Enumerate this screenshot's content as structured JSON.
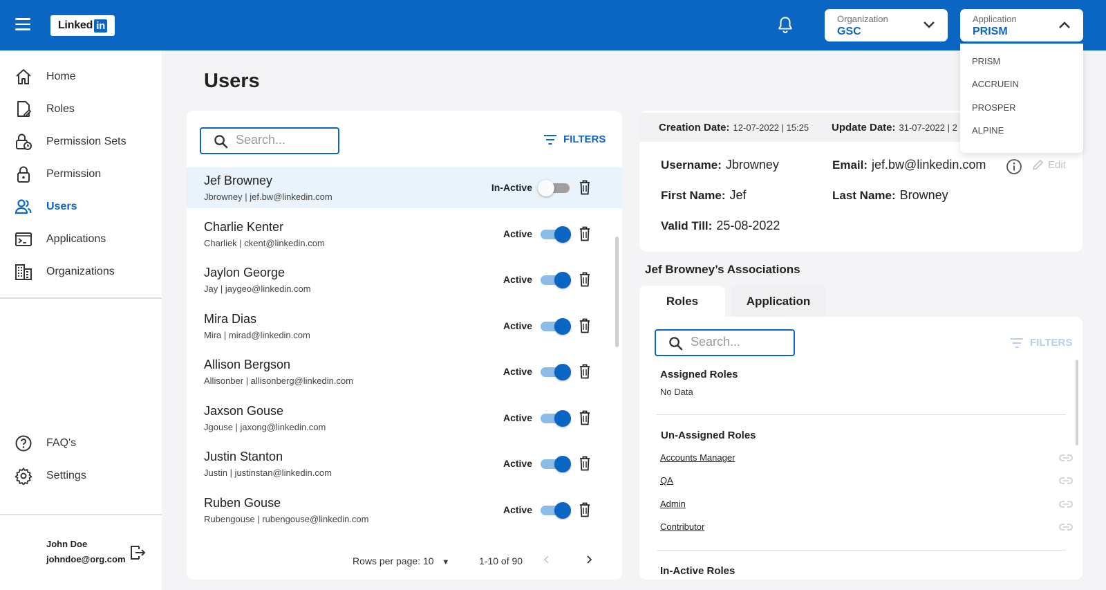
{
  "header": {
    "logo_text": "Linked",
    "logo_in": "in",
    "organization": {
      "label": "Organization",
      "value": "GSC"
    },
    "application": {
      "label": "Application",
      "value": "PRISM",
      "options": [
        "PRISM",
        "ACCRUEIN",
        "PROSPER",
        "ALPINE"
      ]
    }
  },
  "sidebar": {
    "items": [
      {
        "label": "Home",
        "icon": "home-icon"
      },
      {
        "label": "Roles",
        "icon": "roles-icon"
      },
      {
        "label": "Permission Sets",
        "icon": "permission-sets-icon"
      },
      {
        "label": "Permission",
        "icon": "lock-icon"
      },
      {
        "label": "Users",
        "icon": "users-icon",
        "active": true
      },
      {
        "label": "Applications",
        "icon": "terminal-icon"
      },
      {
        "label": "Organizations",
        "icon": "building-icon"
      }
    ],
    "bottom": [
      {
        "label": "FAQ's",
        "icon": "help-icon"
      },
      {
        "label": "Settings",
        "icon": "gear-icon"
      }
    ],
    "user": {
      "name": "John Doe",
      "email": "johndoe@org.com"
    }
  },
  "page": {
    "title": "Users"
  },
  "users_panel": {
    "search_placeholder": "Search...",
    "filters_label": "FILTERS",
    "users": [
      {
        "name": "Jef Browney",
        "sub": "Jbrowney | jef.bw@linkedin.com",
        "status": "In-Active",
        "active": false,
        "selected": true
      },
      {
        "name": "Charlie Kenter",
        "sub": "Charliek | ckent@linkedin.com",
        "status": "Active",
        "active": true
      },
      {
        "name": "Jaylon George",
        "sub": "Jay | jaygeo@linkedin.com",
        "status": "Active",
        "active": true
      },
      {
        "name": "Mira Dias",
        "sub": "Mira | mirad@linkedin.com",
        "status": "Active",
        "active": true
      },
      {
        "name": "Allison Bergson",
        "sub": "Allisonber | allisonberg@linkedin.com",
        "status": "Active",
        "active": true
      },
      {
        "name": "Jaxson Gouse",
        "sub": "Jgouse | jaxong@linkedin.com",
        "status": "Active",
        "active": true
      },
      {
        "name": "Justin Stanton",
        "sub": "Justin | justinstan@linkedin.com",
        "status": "Active",
        "active": true
      },
      {
        "name": "Ruben Gouse",
        "sub": "Rubengouse | rubengouse@linkedin.com",
        "status": "Active",
        "active": true
      }
    ],
    "pagination": {
      "rows_per_page": "Rows per page: 10",
      "range": "1-10 of 90"
    }
  },
  "details": {
    "creation_label": "Creation Date:",
    "creation_value": "12-07-2022 | 15:25",
    "update_label": "Update Date:",
    "update_value": "31-07-2022 | 2",
    "username_label": "Username:",
    "username": "Jbrowney",
    "email_label": "Email:",
    "email": "jef.bw@linkedin.com",
    "firstname_label": "First Name:",
    "firstname": "Jef",
    "lastname_label": "Last Name:",
    "lastname": "Browney",
    "validtill_label": "Valid Till:",
    "validtill": "25-08-2022",
    "edit_label": "Edit"
  },
  "associations": {
    "title": "Jef Browney’s Associations",
    "tabs": [
      "Roles",
      "Application"
    ],
    "search_placeholder": "Search...",
    "filters_label": "FILTERS",
    "assigned_title": "Assigned Roles",
    "assigned_empty": "No Data",
    "unassigned_title": "Un-Assigned Roles",
    "unassigned": [
      "Accounts Manager",
      "QA",
      "Admin",
      "Contributor"
    ],
    "inactive_title": "In-Active Roles"
  }
}
